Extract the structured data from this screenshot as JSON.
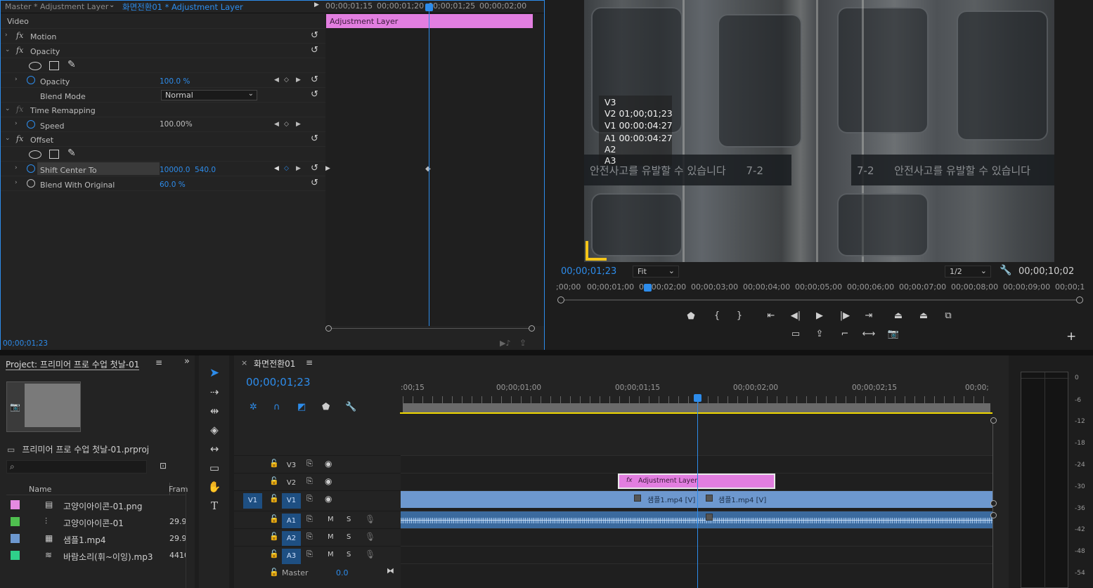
{
  "effect_controls": {
    "tab_master": "Master * Adjustment Layer",
    "tab_active": "화면전환01 * Adjustment Layer",
    "section_video": "Video",
    "motion": "Motion",
    "opacity_group": "Opacity",
    "opacity_param": "Opacity",
    "opacity_value": "100.0 %",
    "blend_mode_label": "Blend Mode",
    "blend_mode_value": "Normal",
    "time_remap": "Time Remapping",
    "speed_label": "Speed",
    "speed_value": "100.00%",
    "offset_group": "Offset",
    "shift_center_label": "Shift Center To",
    "shift_x": "10000.0",
    "shift_y": "540.0",
    "blend_original_label": "Blend With Original",
    "blend_original_value": "60.0 %",
    "ruler": [
      "00;00;01;15",
      "00;00;01;20",
      "00;00;01;25",
      "00;00;02;00"
    ],
    "clip_label": "Adjustment Layer",
    "timecode": "00;00;01;23"
  },
  "program_monitor": {
    "overlay_lines": [
      "V3",
      "V2 01;00;01;23",
      "V1 00:00:04:27",
      "A1 00:00:04:27",
      "A2",
      "A3"
    ],
    "sign_left": "안전사고를 유발할 수 있습니다",
    "sign_mid": "7-2",
    "sign_right_num": "7-2",
    "sign_right": "안전사고를 유발할 수 있습니다",
    "timecode": "00;00;01;23",
    "fit": "Fit",
    "resolution": "1/2",
    "duration": "00;00;10;02",
    "ruler": [
      ";00;00",
      "00;00;01;00",
      "00;00;02;00",
      "00;00;03;00",
      "00;00;04;00",
      "00;00;05;00",
      "00;00;06;00",
      "00;00;07;00",
      "00;00;08;00",
      "00;00;09;00",
      "00;00;1"
    ]
  },
  "project": {
    "title": "Project: 프리미어 프로 수업 첫날-01",
    "project_file": "프리미어 프로 수업 첫날-01.prproj",
    "col_name": "Name",
    "col_frame": "Fram",
    "items": [
      {
        "name": "고양이아이콘-01.png",
        "frame": "",
        "color": "#e58ae0",
        "icon": "image-icon"
      },
      {
        "name": "고양이아이콘-01",
        "frame": "29.9",
        "color": "#4fbf4f",
        "icon": "sequence-icon"
      },
      {
        "name": "샘플1.mp4",
        "frame": "29.9",
        "color": "#6d98cf",
        "icon": "video-icon"
      },
      {
        "name": "바람소리(휘~이잉).mp3",
        "frame": "4410",
        "color": "#2fd08a",
        "icon": "audio-icon"
      }
    ]
  },
  "timeline": {
    "sequence": "화면전환01",
    "timecode": "00;00;01;23",
    "ruler": [
      ":00;15",
      "00;00;01;00",
      "00;00;01;15",
      "00;00;02;00",
      "00;00;02;15",
      "00;00;"
    ],
    "tracks": {
      "v3": "V3",
      "v2": "V2",
      "v1": "V1",
      "v1_src": "V1",
      "a1": "A1",
      "a2": "A2",
      "a3": "A3",
      "m": "M",
      "s": "S"
    },
    "adj_clip": "Adjustment Layer",
    "v1_clip_a": "샘플1.mp4 [V]",
    "v1_clip_b": "샘플1.mp4 [V]",
    "master_label": "Master",
    "master_value": "0.0"
  },
  "meter": {
    "scale": [
      "0",
      "-6",
      "-12",
      "-18",
      "-24",
      "-30",
      "-36",
      "-42",
      "-48",
      "-54"
    ]
  }
}
